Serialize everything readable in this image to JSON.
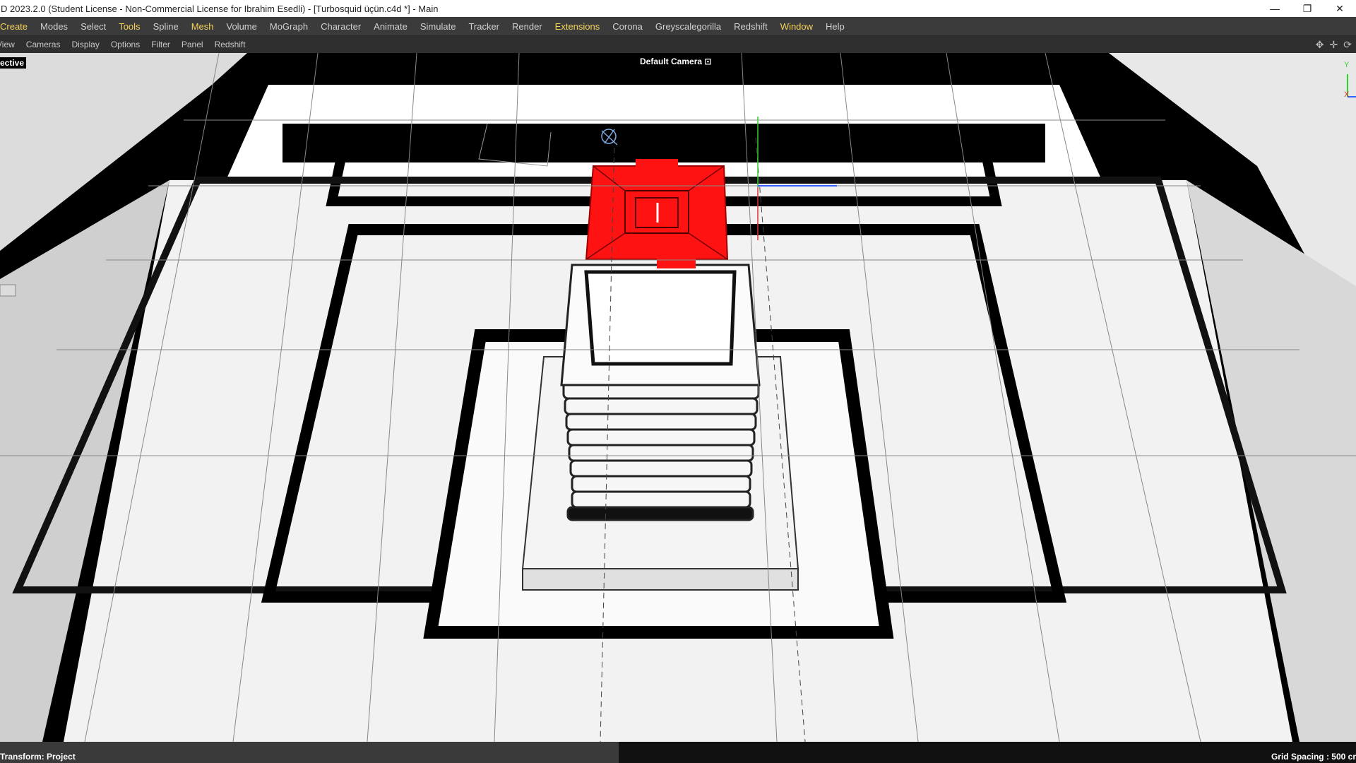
{
  "window": {
    "title": "D 2023.2.0 (Student License - Non-Commercial License for Ibrahim Esedli) - [Turbosquid üçün.c4d *] - Main",
    "controls": [
      "—",
      "❐",
      "✕"
    ]
  },
  "menubar": {
    "items": [
      {
        "label": "Create",
        "accent": true
      },
      {
        "label": "Modes",
        "accent": false
      },
      {
        "label": "Select",
        "accent": false
      },
      {
        "label": "Tools",
        "accent": true
      },
      {
        "label": "Spline",
        "accent": false
      },
      {
        "label": "Mesh",
        "accent": true
      },
      {
        "label": "Volume",
        "accent": false
      },
      {
        "label": "MoGraph",
        "accent": false
      },
      {
        "label": "Character",
        "accent": false
      },
      {
        "label": "Animate",
        "accent": false
      },
      {
        "label": "Simulate",
        "accent": false
      },
      {
        "label": "Tracker",
        "accent": false
      },
      {
        "label": "Render",
        "accent": false
      },
      {
        "label": "Extensions",
        "accent": true
      },
      {
        "label": "Corona",
        "accent": false
      },
      {
        "label": "Greyscalegorilla",
        "accent": false
      },
      {
        "label": "Redshift",
        "accent": false
      },
      {
        "label": "Window",
        "accent": true
      },
      {
        "label": "Help",
        "accent": false
      }
    ]
  },
  "viewport_menu": {
    "items": [
      "View",
      "Cameras",
      "Display",
      "Options",
      "Filter",
      "Panel",
      "Redshift"
    ],
    "nav_icons": [
      "move-view-icon",
      "pan-view-icon",
      "rotate-view-icon"
    ]
  },
  "viewport": {
    "projection": "ective",
    "camera": "Default Camera",
    "axis_labels": {
      "y": "Y",
      "x": "X"
    },
    "colors": {
      "selection": "#ff1212",
      "background": "#000000",
      "axis_x": "#e03030",
      "axis_y": "#30d030",
      "axis_z": "#3060ff"
    }
  },
  "status": {
    "transform": "Transform: Project",
    "grid": "Grid Spacing : 500 cr"
  }
}
